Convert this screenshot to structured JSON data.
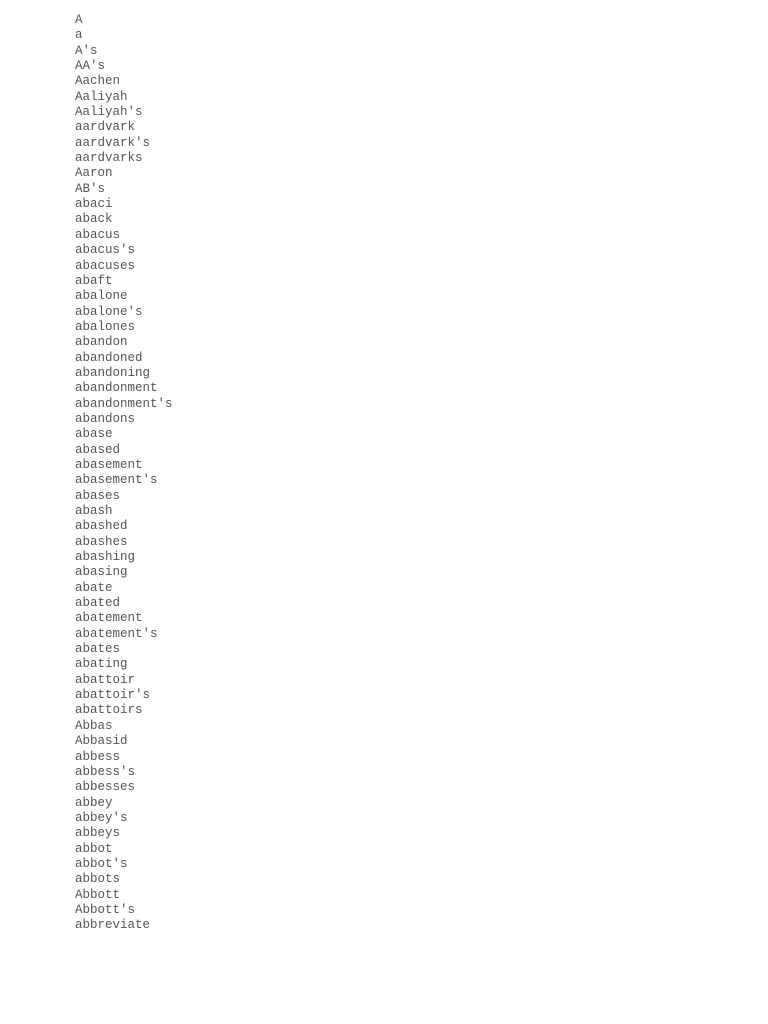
{
  "document": {
    "words": [
      "A",
      "a",
      "A's",
      "AA's",
      "Aachen",
      "Aaliyah",
      "Aaliyah's",
      "aardvark",
      "aardvark's",
      "aardvarks",
      "Aaron",
      "AB's",
      "abaci",
      "aback",
      "abacus",
      "abacus's",
      "abacuses",
      "abaft",
      "abalone",
      "abalone's",
      "abalones",
      "abandon",
      "abandoned",
      "abandoning",
      "abandonment",
      "abandonment's",
      "abandons",
      "abase",
      "abased",
      "abasement",
      "abasement's",
      "abases",
      "abash",
      "abashed",
      "abashes",
      "abashing",
      "abasing",
      "abate",
      "abated",
      "abatement",
      "abatement's",
      "abates",
      "abating",
      "abattoir",
      "abattoir's",
      "abattoirs",
      "Abbas",
      "Abbasid",
      "abbess",
      "abbess's",
      "abbesses",
      "abbey",
      "abbey's",
      "abbeys",
      "abbot",
      "abbot's",
      "abbots",
      "Abbott",
      "Abbott's",
      "abbreviate"
    ]
  }
}
